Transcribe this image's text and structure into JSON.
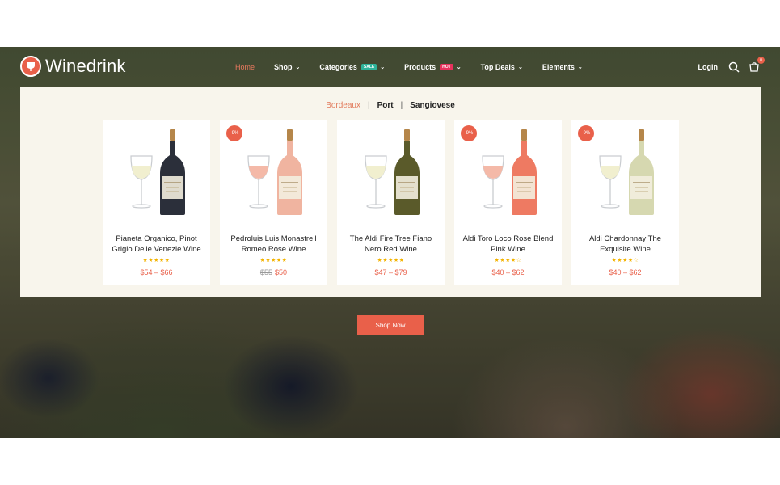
{
  "brand": {
    "name": "Winedrink"
  },
  "nav": {
    "home": "Home",
    "shop": "Shop",
    "categories": "Categories",
    "categories_badge": "SALE",
    "products": "Products",
    "products_badge": "HOT",
    "top_deals": "Top Deals",
    "elements": "Elements"
  },
  "header_right": {
    "login": "Login",
    "cart_count": "0"
  },
  "mega_menu": {
    "tabs": [
      "Bordeaux",
      "Port",
      "Sangiovese"
    ],
    "products": [
      {
        "name": "Pianeta Organico, Pinot Grigio Delle Venezie Wine",
        "discount": "",
        "stars": "★★★★★",
        "old_price": "",
        "price": "$54 – $66",
        "wine": "white",
        "bottle": "#2b2f3a"
      },
      {
        "name": "Pedroluis Luis Monastrell Romeo Rose Wine",
        "discount": "-9%",
        "stars": "★★★★★",
        "old_price": "$55",
        "price": "$50",
        "wine": "rose",
        "bottle": "#f0b4a0"
      },
      {
        "name": "The Aldi Fire Tree Fiano Nero Red Wine",
        "discount": "",
        "stars": "★★★★★",
        "old_price": "",
        "price": "$47 – $79",
        "wine": "white",
        "bottle": "#5a5a2a"
      },
      {
        "name": "Aldi Toro Loco Rose Blend Pink Wine",
        "discount": "-9%",
        "stars": "★★★★☆",
        "old_price": "",
        "price": "$40 – $62",
        "wine": "rose",
        "bottle": "#ee7a62"
      },
      {
        "name": "Aldi Chardonnay The Exquisite Wine",
        "discount": "-9%",
        "stars": "★★★★☆",
        "old_price": "",
        "price": "$40 – $62",
        "wine": "white",
        "bottle": "#d6d8b0"
      }
    ]
  },
  "cta": {
    "label": "Shop Now"
  },
  "colors": {
    "accent": "#e9604a",
    "menu_bg": "#f8f5ec",
    "star": "#f3b300"
  }
}
